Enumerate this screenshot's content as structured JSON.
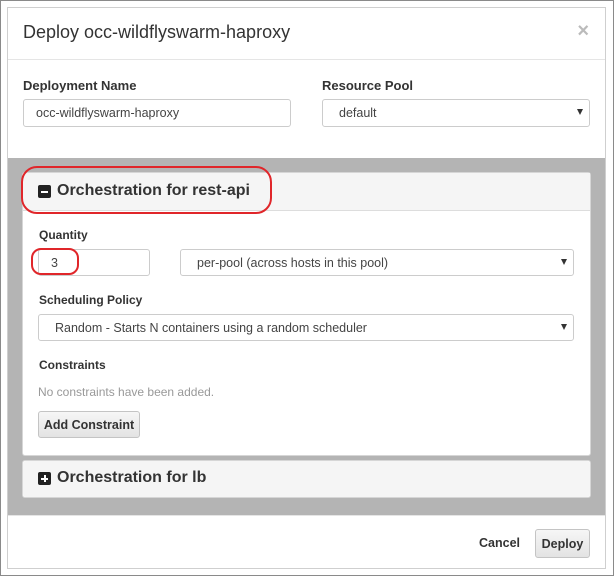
{
  "modal": {
    "title": "Deploy occ-wildflyswarm-haproxy",
    "close_glyph": "×"
  },
  "form": {
    "deployment_name_label": "Deployment Name",
    "deployment_name_value": "occ-wildflyswarm-haproxy",
    "resource_pool_label": "Resource Pool",
    "resource_pool_value": "default"
  },
  "panels": [
    {
      "title": "Orchestration for rest-api",
      "expanded": true,
      "quantity_label": "Quantity",
      "quantity_value": "3",
      "quantity_mode": "per-pool (across hosts in this pool)",
      "scheduling_label": "Scheduling Policy",
      "scheduling_value": "Random - Starts N containers using a random scheduler",
      "constraints_label": "Constraints",
      "constraints_empty": "No constraints have been added.",
      "add_constraint_label": "Add Constraint"
    },
    {
      "title": "Orchestration for lb",
      "expanded": false
    }
  ],
  "footer": {
    "cancel_label": "Cancel",
    "deploy_label": "Deploy"
  },
  "colors": {
    "annotation": "#e0262a",
    "backdrop": "#b4b4b4"
  }
}
